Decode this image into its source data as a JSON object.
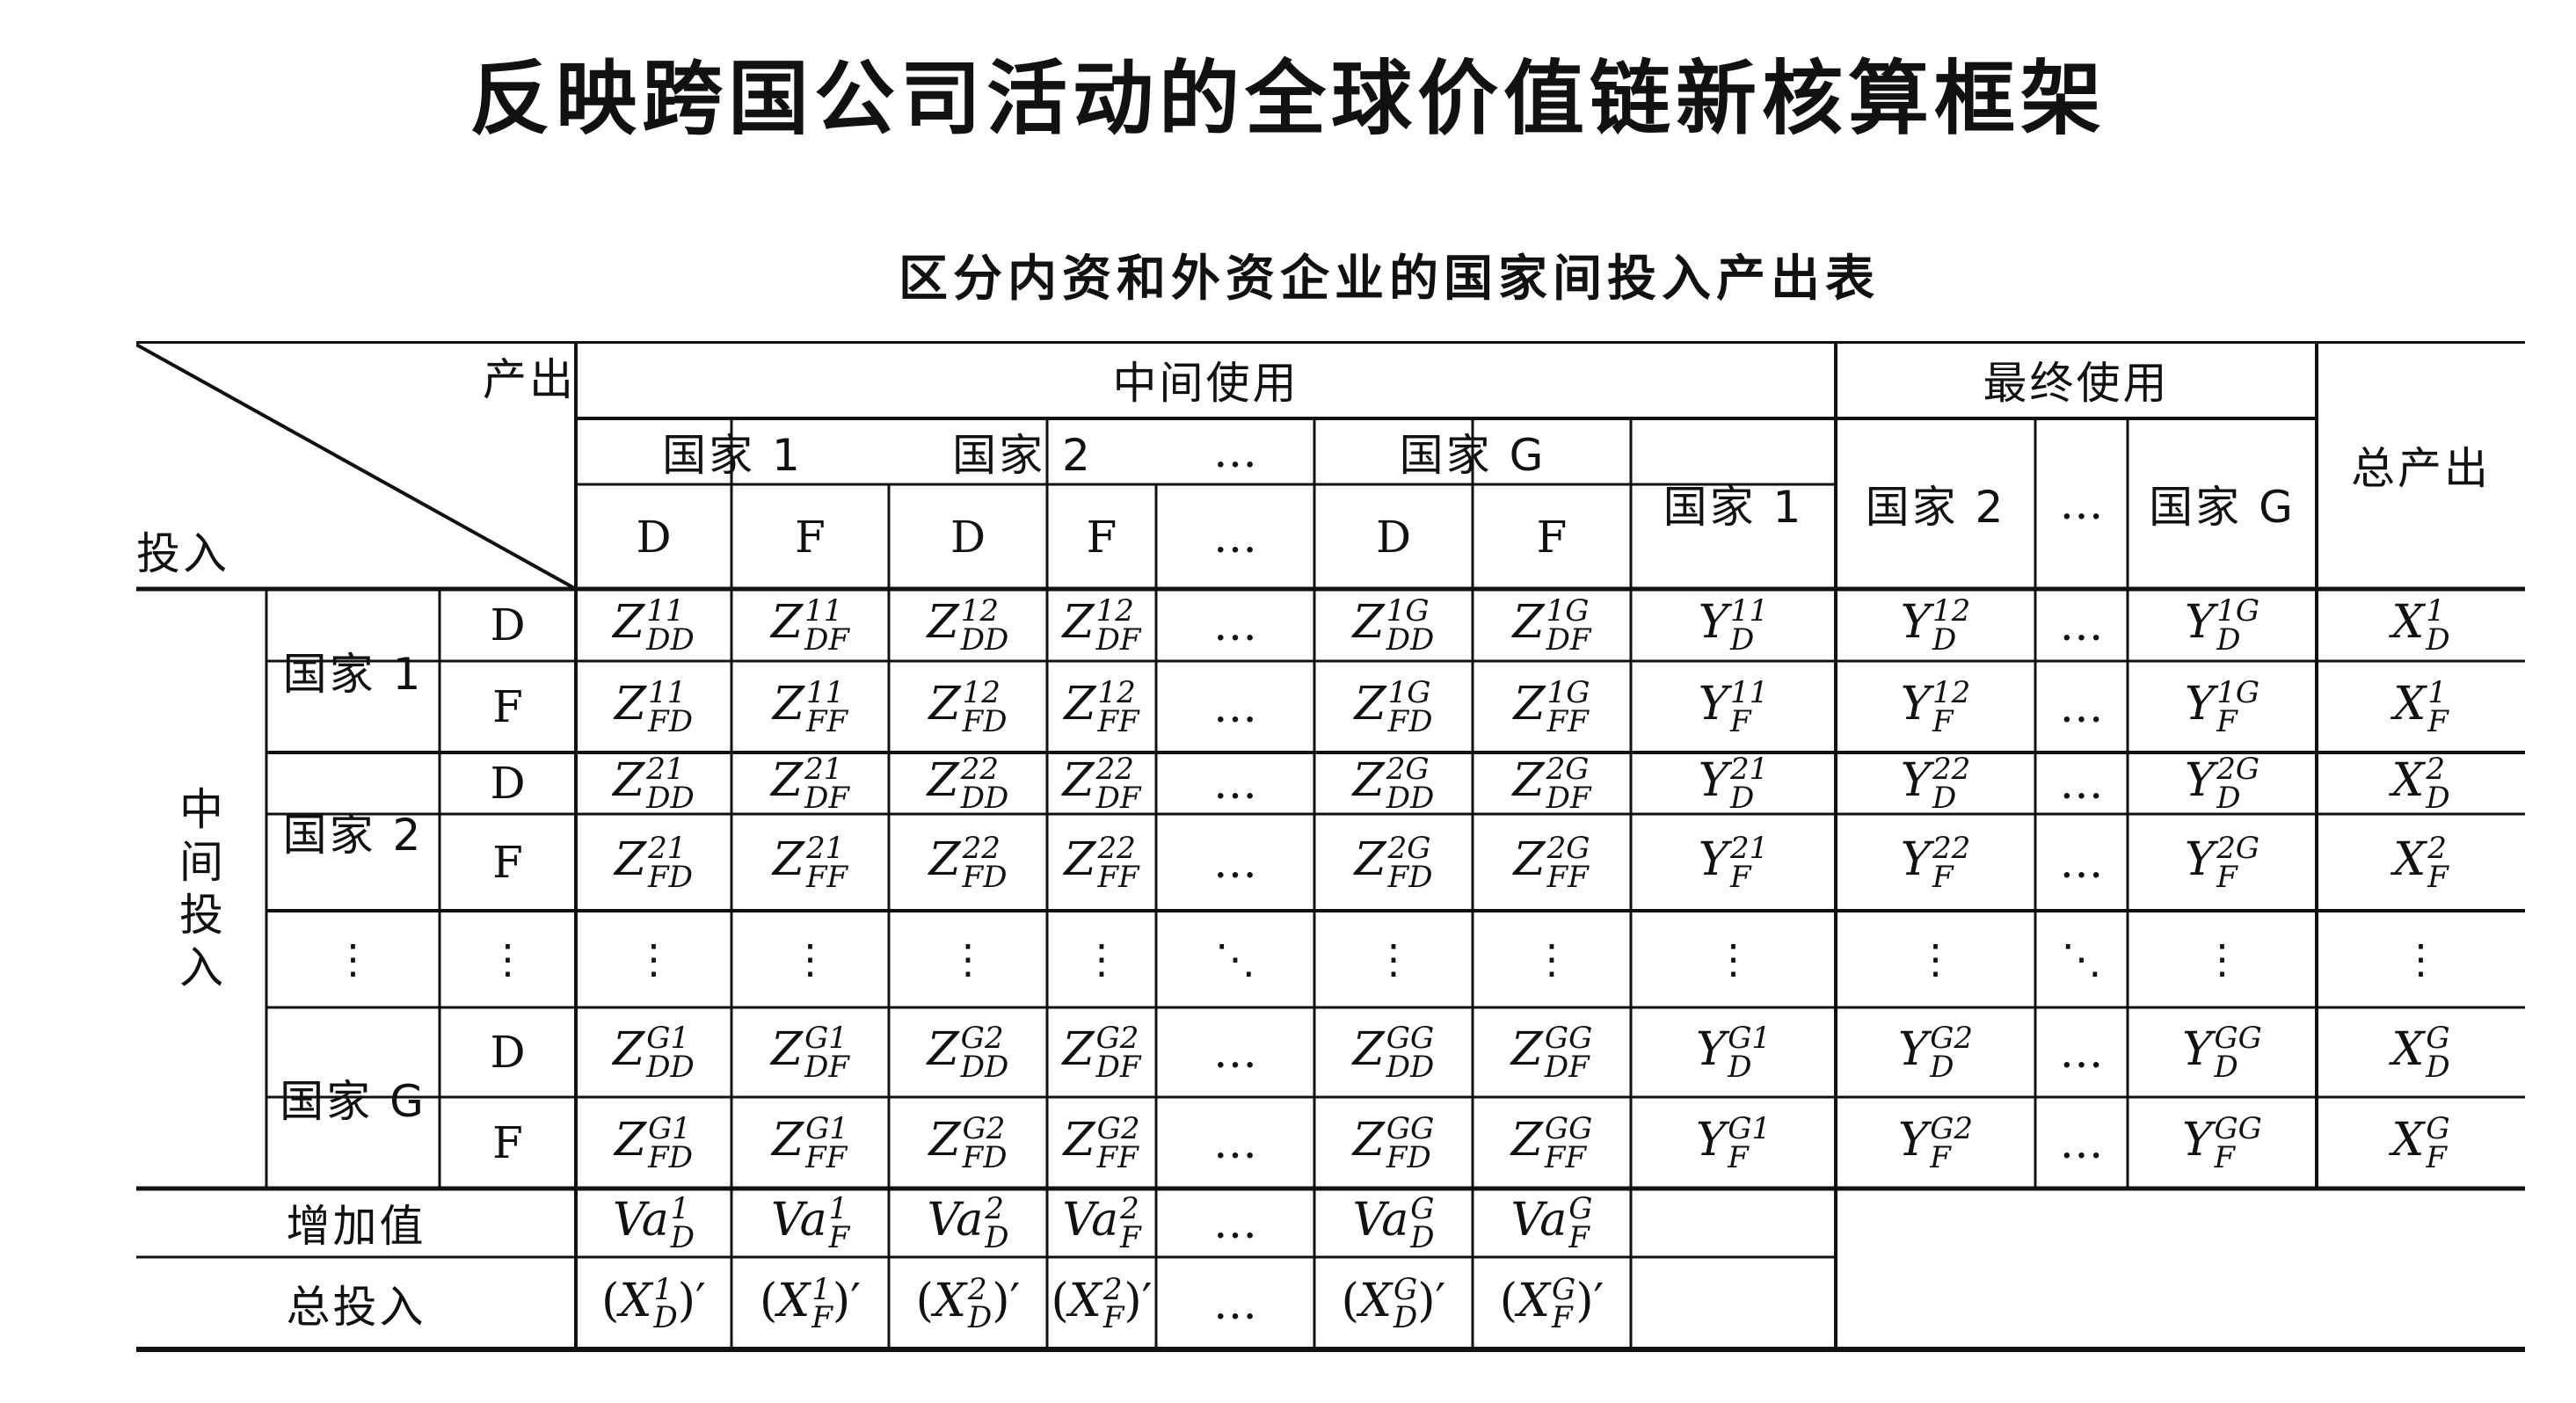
{
  "title": "反映跨国公司活动的全球价值链新核算框架",
  "subtitle": "区分内资和外资企业的国家间投入产出表",
  "table": {
    "corner_output": "产出",
    "corner_input": "投入",
    "intermediate_use": "中间使用",
    "final_use": "最终使用",
    "total_output": "总产出",
    "country_headers": [
      "国家 1",
      "国家 2",
      "…",
      "国家 G"
    ],
    "firm_types": [
      "D",
      "F"
    ],
    "ellipsis": "…",
    "intermediate_input": "中间投入",
    "row_groups": [
      "国家 1",
      "国家 2",
      "国家 G"
    ],
    "value_added": "增加值",
    "total_input": "总投入",
    "row_pairs": [
      [
        "1",
        "D"
      ],
      [
        "1",
        "F"
      ],
      [
        "2",
        "D"
      ],
      [
        "2",
        "F"
      ],
      [
        "G",
        "D"
      ],
      [
        "G",
        "F"
      ]
    ],
    "col_pairs": [
      [
        "1",
        "D"
      ],
      [
        "1",
        "F"
      ],
      [
        "2",
        "D"
      ],
      [
        "2",
        "F"
      ],
      [
        "G",
        "D"
      ],
      [
        "G",
        "F"
      ]
    ],
    "final_countries": [
      "1",
      "2",
      "G"
    ]
  }
}
